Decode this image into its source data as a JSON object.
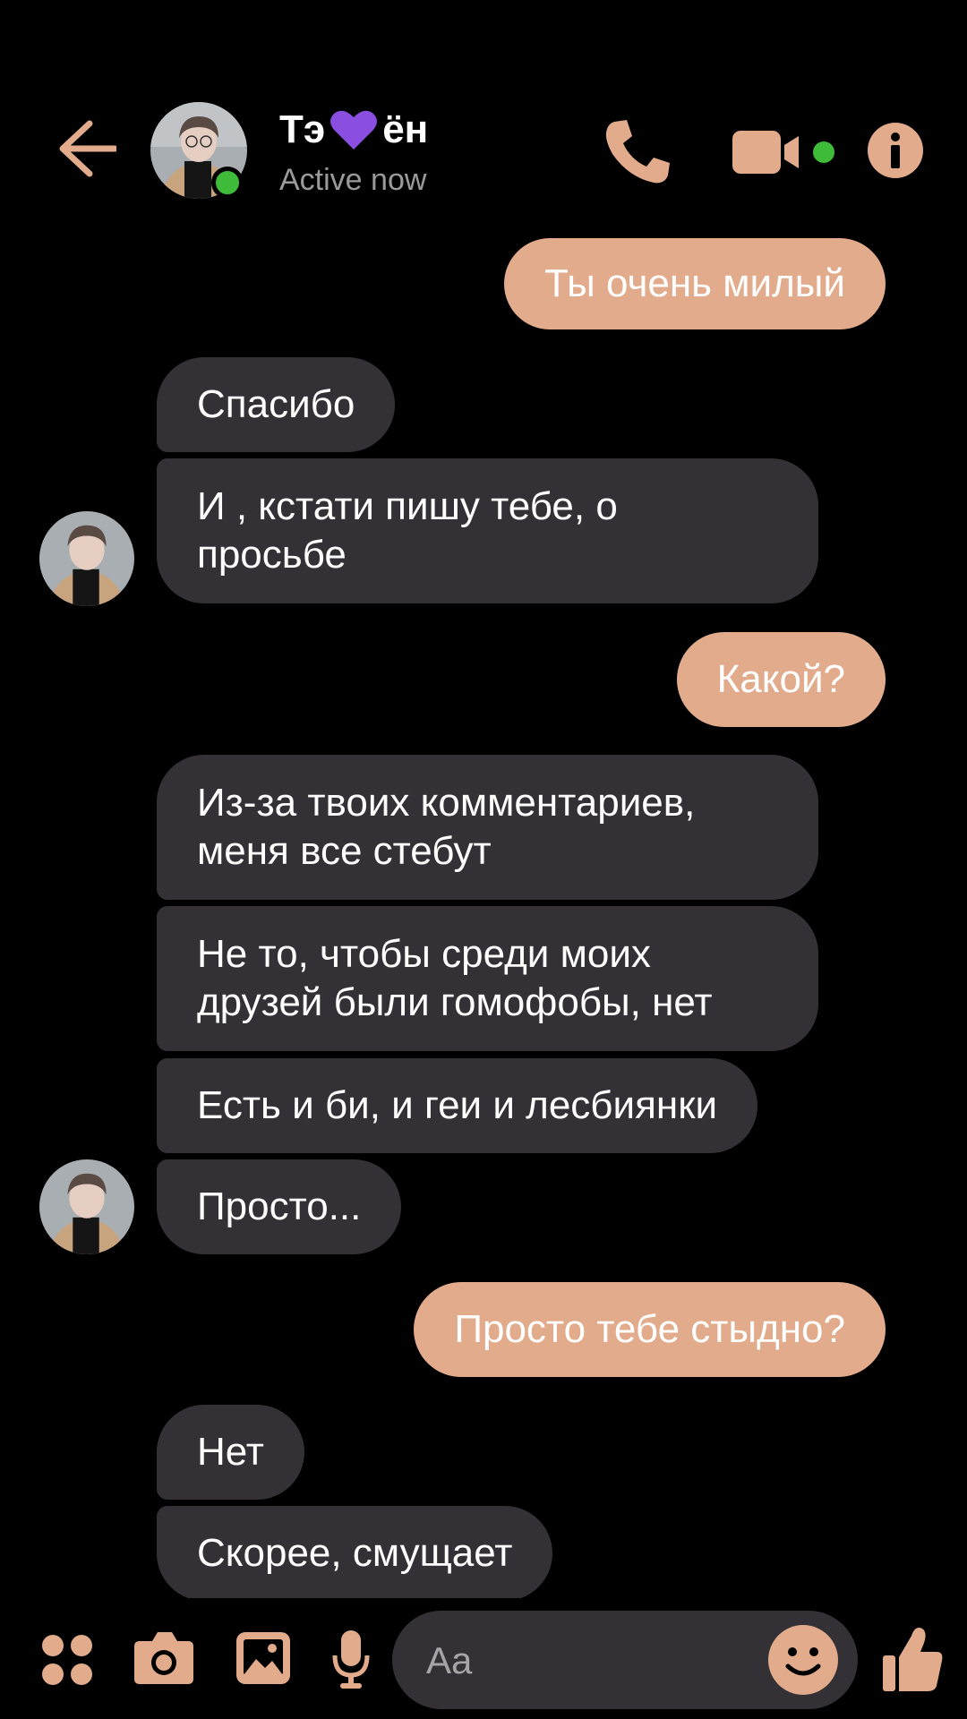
{
  "colors": {
    "accent": "#e1ab8c",
    "incoming_bubble": "#333135",
    "background": "#000000",
    "online": "#3fbb3a",
    "heart": "#8a4fe0"
  },
  "header": {
    "name_prefix": "Тэ",
    "name_suffix": "ён",
    "status": "Active now",
    "icons": [
      "back-arrow-icon",
      "phone-icon",
      "video-camera-icon",
      "info-icon"
    ]
  },
  "messages": [
    {
      "direction": "outgoing",
      "text": "Ты очень милый"
    },
    {
      "direction": "incoming",
      "text": "Спасибо"
    },
    {
      "direction": "incoming",
      "text": "И , кстати пишу тебе, о",
      "text2": "просьбе"
    },
    {
      "direction": "outgoing",
      "text": "Какой?"
    },
    {
      "direction": "incoming",
      "text": "Из-за твоих комментариев,",
      "text2": "меня все стебут"
    },
    {
      "direction": "incoming",
      "text": "Не то, чтобы среди моих",
      "text2": "друзей были гомофобы, нет"
    },
    {
      "direction": "incoming",
      "text": "Есть и би, и геи и лесбиянки"
    },
    {
      "direction": "incoming",
      "text": "Просто..."
    },
    {
      "direction": "outgoing",
      "text": "Просто тебе стыдно?"
    },
    {
      "direction": "incoming",
      "text": "Нет"
    },
    {
      "direction": "incoming",
      "text": "Скорее, смущает"
    }
  ],
  "composer": {
    "placeholder": "Aa",
    "icons": [
      "apps-grid-icon",
      "camera-icon",
      "gallery-icon",
      "microphone-icon",
      "emoji-icon",
      "thumbs-up-icon"
    ]
  }
}
